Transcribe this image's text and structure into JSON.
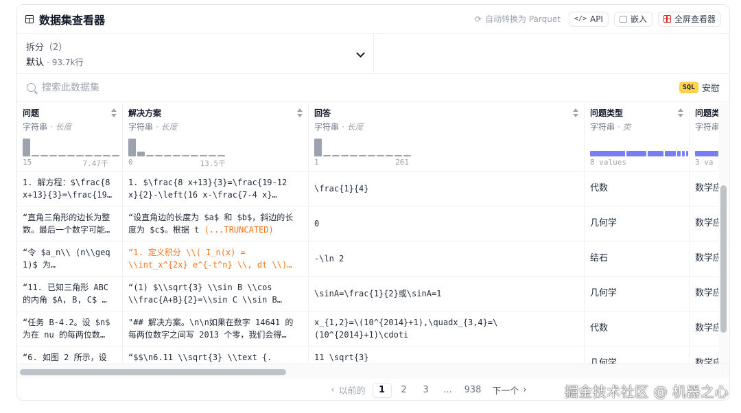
{
  "header": {
    "title": "数据集查看器",
    "convert_label": "自动转换为 Parquet",
    "api_label": "API",
    "embed_label": "嵌入",
    "fullscreen_label": "全屏查看器"
  },
  "split": {
    "label": "拆分",
    "count": "（2）",
    "value": "默认",
    "meta": "· 93.7k行"
  },
  "search": {
    "placeholder": "搜索此数据集",
    "sql_badge": "SQL",
    "sql_label": "安慰"
  },
  "columns": [
    {
      "name": "问题",
      "type": "字符串",
      "stat": "· 长度",
      "range_min": "15",
      "range_max": "7.47千",
      "hist": [
        1.0,
        0.08,
        0.08,
        0.08,
        0.08,
        0.08,
        0.08,
        0.08,
        0.08,
        0.08,
        0.08
      ]
    },
    {
      "name": "解决方案",
      "type": "字符串",
      "stat": "· 长度",
      "range_min": "0",
      "range_max": "13.5千",
      "hist": [
        1.0,
        0.25,
        0.08,
        0.08,
        0.08,
        0.08,
        0.08,
        0.08,
        0.08,
        0.08,
        0.08
      ]
    },
    {
      "name": "回答",
      "type": "字符串",
      "stat": "· 长度",
      "range_min": "1",
      "range_max": "261",
      "hist": [
        1.0,
        0.08,
        0.08,
        0.08,
        0.08,
        0.08,
        0.08,
        0.08,
        0.08,
        0.08,
        0.08
      ]
    },
    {
      "name": "问题类型",
      "type": "字符串",
      "stat": "· 类",
      "values_label": "8 values",
      "segments": [
        0.38,
        0.22,
        0.17,
        0.12,
        0.04,
        0.03,
        0.02,
        0.02
      ]
    },
    {
      "name": "问题类",
      "type": "字符串",
      "values_label": "3 va"
    }
  ],
  "rows": [
    {
      "c1": [
        "1. 解方程：$\\frac{8",
        "x+13}{3}=\\frac{19…"
      ],
      "c2": [
        "1. $\\frac{8 x+13}{3}=\\frac{19-12",
        "x}{2}-\\left(16 x-\\frac{7-4 x}…"
      ],
      "c3": [
        "\\frac{1}{4}"
      ],
      "c4": "代数",
      "c5": "数学应"
    },
    {
      "c1": [
        "“直角三角形的边长为整",
        "数。最后一个数字可能…"
      ],
      "c2": [
        "“设直角边的长度为 $a$ 和 $b$，斜边的长",
        "度为 $c$。根据 t "
      ],
      "c2_trunc": "(...TRUNCATED)",
      "c3": [
        "0"
      ],
      "c4": "几何学",
      "c5": "数学应"
    },
    {
      "c1": [
        "“令 $a_n\\\\ (n\\\\geq",
        "1)$ 为…"
      ],
      "c2_orange": [
        "“1. 定义积分 \\\\( I_n(x) =",
        "\\\\int_x^{2x} e^{-t^n} \\\\, dt \\\\)…"
      ],
      "c3": [
        "-\\ln 2"
      ],
      "c4": "结石",
      "c5": "数学应"
    },
    {
      "c1": [
        "“11. 已知三角形 ABC",
        "的内角 $A, B, C$ …"
      ],
      "c2": [
        "“(1) $\\\\sqrt{3} \\\\sin B \\\\cos",
        "\\\\frac{A+B}{2}=\\\\sin C \\\\sin B…"
      ],
      "c3": [
        "\\sinA=\\frac{1}{2}或\\sinA=1"
      ],
      "c4": "几何学",
      "c5": "数学应"
    },
    {
      "c1": [
        "“任务 B-4.2。设 $n$",
        "为在 nu 的每两位数…"
      ],
      "c2": [
        "\"## 解决方案。\\n\\n如果在数字 14641 的",
        "每两位数字之间写 2013 个零，我们会得…"
      ],
      "c3": [
        "x_{1,2}=\\(10^{2014}+1),\\quadx_{3,4}=\\",
        "(10^{2014}+1)\\cdoti"
      ],
      "c4": "代数",
      "c5": "数学应"
    },
    {
      "c1": [
        "“6. 如图 2 所示，设"
      ],
      "c2": [
        "“$$\\n6.11 \\\\sqrt{3} \\\\text {."
      ],
      "c3": [
        "11 \\sqrt{3}"
      ],
      "c4": "几何学",
      "c5": "数学应"
    }
  ],
  "pagination": {
    "prev": "以前的",
    "pages": [
      "1",
      "2",
      "3",
      "...",
      "938"
    ],
    "next": "下一个"
  },
  "watermark": "掘金技术社区 @ 机器之心"
}
